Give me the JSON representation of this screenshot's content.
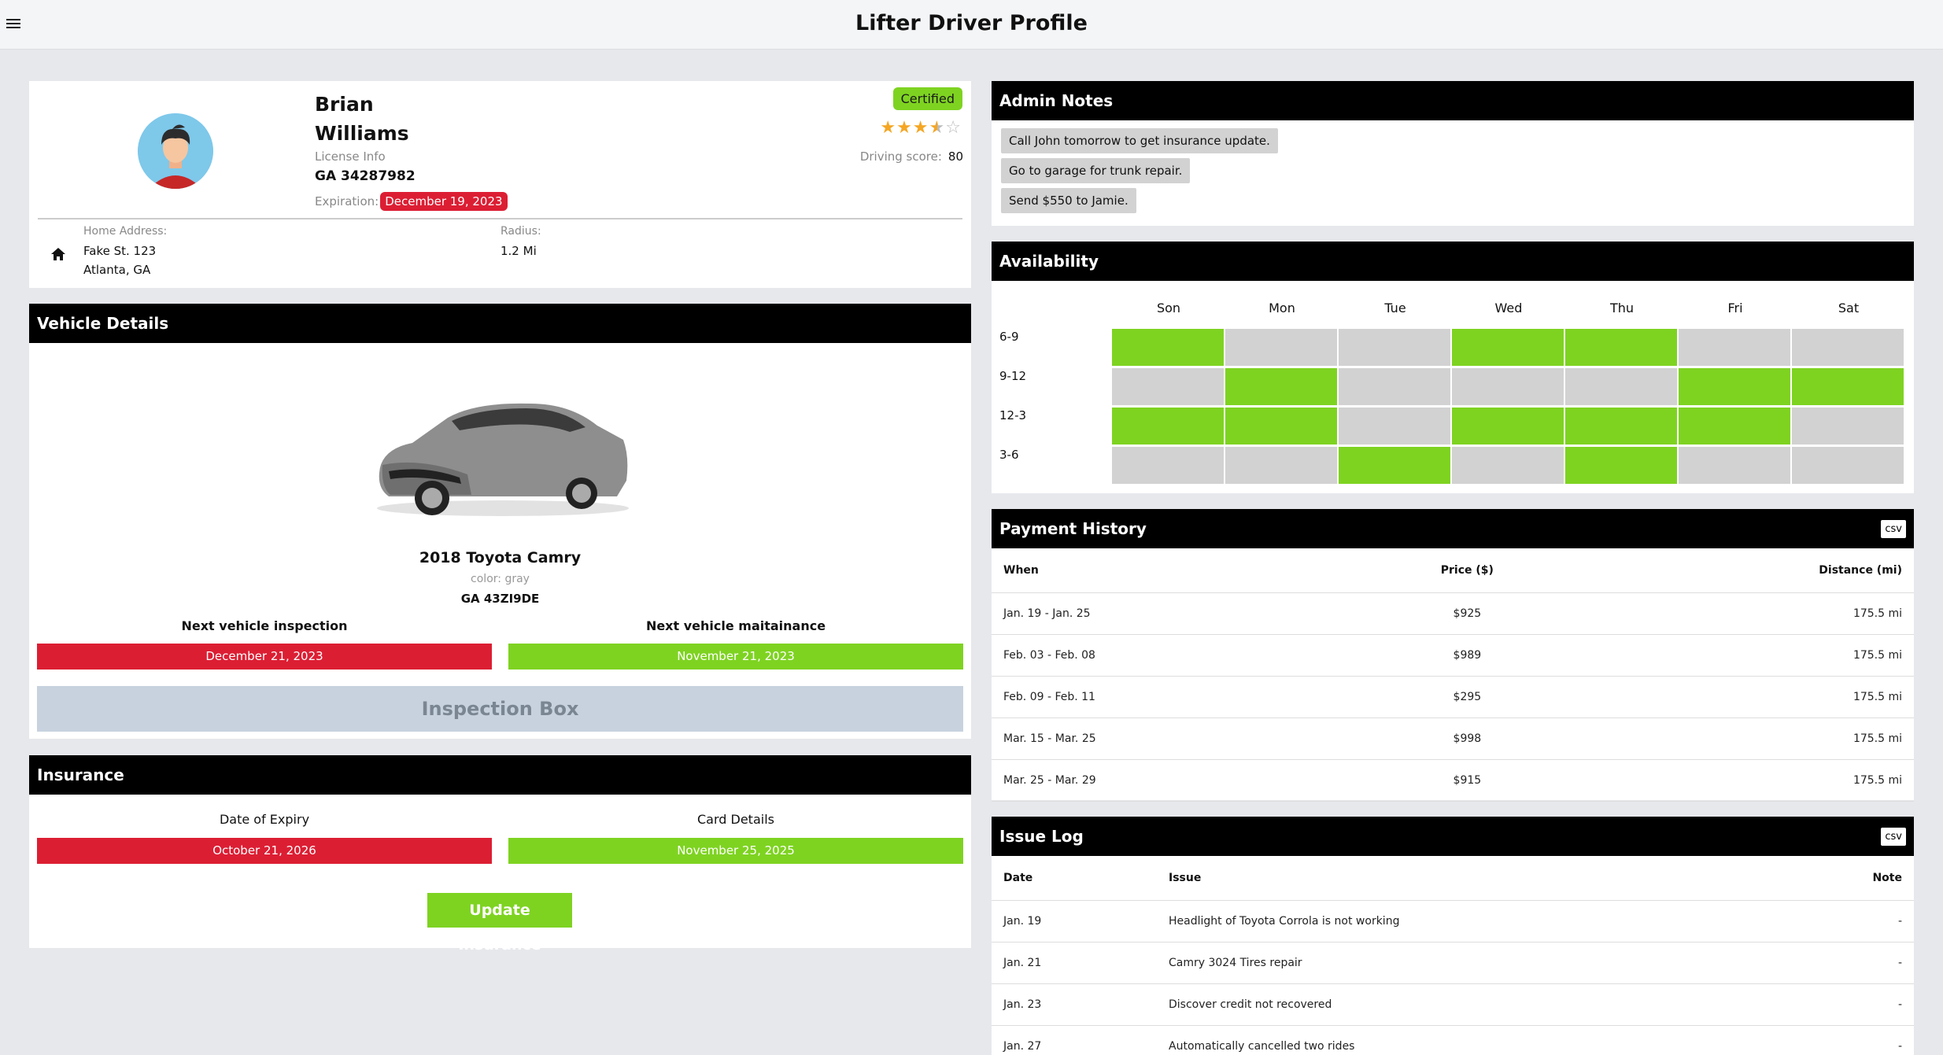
{
  "header": {
    "title": "Lifter Driver Profile",
    "menu_icon": "hamburger-menu-icon"
  },
  "profile": {
    "first_name": "Brian",
    "last_name": "Williams",
    "license_label": "License Info",
    "license_number": "GA 34287982",
    "expiration_label": "Expiration:",
    "expiration_date": "December 19, 2023",
    "status_badge": "Certified",
    "rating": 3.5,
    "rating_max": 5,
    "driving_score_label": "Driving score:",
    "driving_score": "80",
    "home_address_label": "Home Address:",
    "address_line1": "Fake St. 123",
    "address_line2": "Atlanta, GA",
    "radius_label": "Radius:",
    "radius": "1.2 Mi"
  },
  "vehicle": {
    "title": "Vehicle Details",
    "name": "2018 Toyota Camry",
    "color": "color: gray",
    "plate": "GA 43ZI9DE",
    "inspection_label": "Next vehicle inspection",
    "inspection_date": "December 21, 2023",
    "maintenance_label": "Next vehicle maitainance",
    "maintenance_date": "November 21, 2023",
    "inspection_box_label": "Inspection Box"
  },
  "insurance": {
    "title": "Insurance",
    "expiry_label": "Date of Expiry",
    "expiry_date": "October 21, 2026",
    "card_label": "Card Details",
    "card_date": "November 25, 2025",
    "update_button": "Update Insurance"
  },
  "admin_notes": {
    "title": "Admin Notes",
    "notes": [
      "Call John tomorrow to get insurance update.",
      "Go to garage for trunk repair.",
      "Send $550 to Jamie."
    ]
  },
  "availability": {
    "title": "Availability",
    "days": [
      "Son",
      "Mon",
      "Tue",
      "Wed",
      "Thu",
      "Fri",
      "Sat"
    ],
    "slots": [
      "6-9",
      "9-12",
      "12-3",
      "3-6"
    ],
    "grid": [
      [
        1,
        0,
        0,
        1,
        1,
        0,
        0
      ],
      [
        0,
        1,
        0,
        0,
        0,
        1,
        1
      ],
      [
        1,
        1,
        0,
        1,
        1,
        1,
        0
      ],
      [
        0,
        0,
        1,
        0,
        1,
        0,
        0
      ]
    ]
  },
  "payment_history": {
    "title": "Payment History",
    "csv_label": "csv",
    "columns": [
      "When",
      "Price ($)",
      "Distance (mi)"
    ],
    "rows": [
      [
        "Jan. 19 - Jan. 25",
        "$925",
        "175.5 mi"
      ],
      [
        "Feb. 03 - Feb. 08",
        "$989",
        "175.5 mi"
      ],
      [
        "Feb. 09 - Feb. 11",
        "$295",
        "175.5 mi"
      ],
      [
        "Mar. 15 - Mar. 25",
        "$998",
        "175.5 mi"
      ],
      [
        "Mar. 25 - Mar. 29",
        "$915",
        "175.5 mi"
      ]
    ]
  },
  "issue_log": {
    "title": "Issue Log",
    "csv_label": "csv",
    "columns": [
      "Date",
      "Issue",
      "Note"
    ],
    "rows": [
      [
        "Jan. 19",
        "Headlight of Toyota Corrola is not working",
        "-"
      ],
      [
        "Jan. 21",
        "Camry 3024 Tires repair",
        "-"
      ],
      [
        "Jan. 23",
        "Discover credit not recovered",
        "-"
      ],
      [
        "Jan. 27",
        "Automatically cancelled two rides",
        "-"
      ]
    ]
  },
  "colors": {
    "red": "#dc1e33",
    "green": "#7ed321",
    "grey_cell": "#d2d2d2",
    "header_bg": "#000000"
  }
}
